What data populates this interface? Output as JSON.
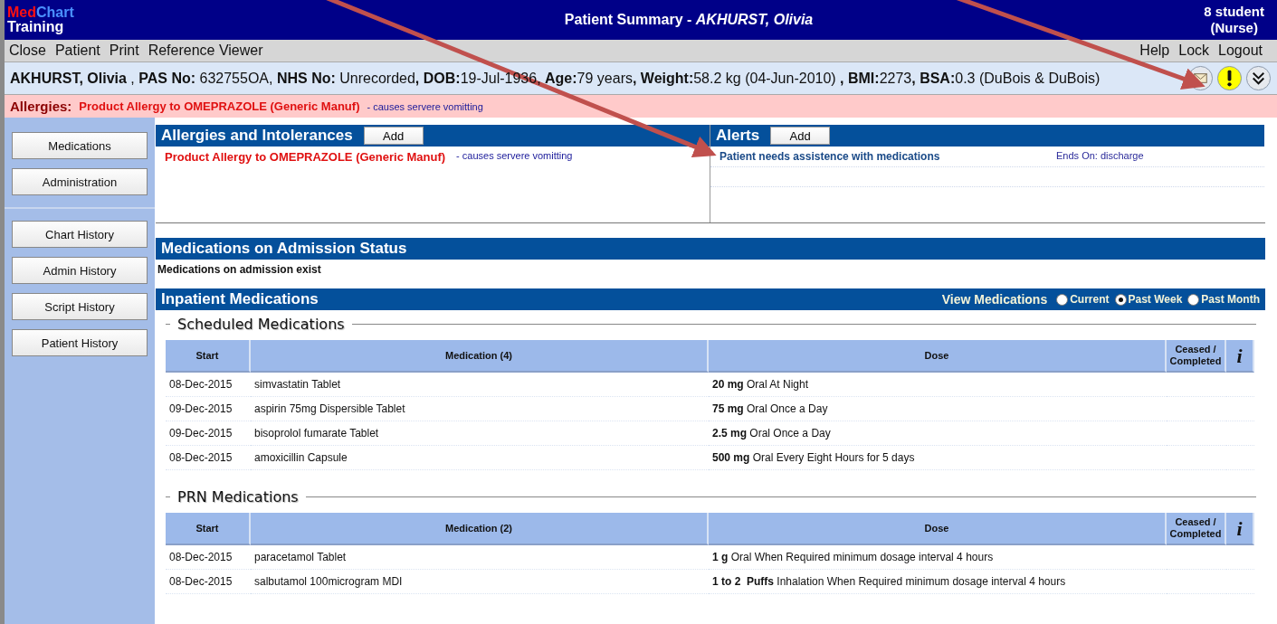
{
  "header": {
    "logo_part_1": "Med",
    "logo_part_2": "Chart",
    "subtitle": "Training",
    "title": "Patient Summary - *AKHURST, Olivia*",
    "user_line_1": "8 student",
    "user_line_2": "(Nurse)"
  },
  "menu": {
    "left": [
      "Close",
      "Patient",
      "Print",
      "Reference Viewer"
    ],
    "right": [
      "Help",
      "Lock",
      "Logout"
    ]
  },
  "patient_bar": "**AKHURST, Olivia** , **PAS No:** 632755OA, **NHS No:** Unrecorded**, DOB:**19-Jul-1936, **Age:**79 years**, Weight:**58.2 kg (04-Jun-2010) **, BMI:**2273**, BSA:**0.3 (DuBois & DuBois)",
  "allergy_bar": {
    "label": "Allergies:",
    "allergy": "Product Allergy to OMEPRAZOLE (Generic Manuf)",
    "reaction": "- causes servere vomitting"
  },
  "sidebar": {
    "groups": [
      [
        "Medications",
        "Administration"
      ],
      [
        "Chart History",
        "Admin History",
        "Script History",
        "Patient History"
      ]
    ]
  },
  "allergies_panel": {
    "title": "Allergies and Intolerances",
    "add_button": "Add",
    "items": [
      {
        "name": "Product Allergy to OMEPRAZOLE (Generic Manuf)",
        "reaction": "- causes servere vomitting"
      }
    ]
  },
  "alerts_panel": {
    "title": "Alerts",
    "add_button": "Add",
    "items": [
      {
        "text": "Patient needs assistence with medications",
        "ends": "Ends On: discharge"
      }
    ]
  },
  "admission_status": {
    "title": "Medications on Admission Status",
    "text": "Medications on admission exist"
  },
  "inpatient": {
    "title": "Inpatient Medications",
    "view_label": "View Medications",
    "options": [
      {
        "label": "Current",
        "selected": false
      },
      {
        "label": "Past Week",
        "selected": true
      },
      {
        "label": "Past Month",
        "selected": false
      }
    ],
    "sections": [
      {
        "legend": "Scheduled Medications",
        "columns": [
          "Start",
          "Medication (4)",
          "Dose",
          "Ceased / Completed",
          "i"
        ],
        "rows": [
          {
            "start": "08-Dec-2015",
            "medication": "simvastatin Tablet",
            "dose": "**20 mg** Oral At Night"
          },
          {
            "start": "09-Dec-2015",
            "medication": "aspirin 75mg Dispersible Tablet",
            "dose": "**75 mg** Oral Once a Day"
          },
          {
            "start": "09-Dec-2015",
            "medication": "bisoprolol fumarate Tablet",
            "dose": "**2.5 mg** Oral Once a Day"
          },
          {
            "start": "08-Dec-2015",
            "medication": "amoxicillin Capsule",
            "dose": "**500 mg** Oral Every Eight Hours for 5 days"
          }
        ]
      },
      {
        "legend": "PRN Medications",
        "columns": [
          "Start",
          "Medication (2)",
          "Dose",
          "Ceased / Completed",
          "i"
        ],
        "rows": [
          {
            "start": "08-Dec-2015",
            "medication": "paracetamol Tablet",
            "dose": "**1 g** Oral When Required minimum dosage interval 4 hours"
          },
          {
            "start": "08-Dec-2015",
            "medication": "salbutamol 100microgram MDI",
            "dose": "**1 to 2  Puffs** Inhalation When Required minimum dosage interval 4 hours"
          }
        ]
      }
    ]
  },
  "annotations": [
    {
      "kind": "arrow"
    },
    {
      "kind": "arrow"
    }
  ]
}
